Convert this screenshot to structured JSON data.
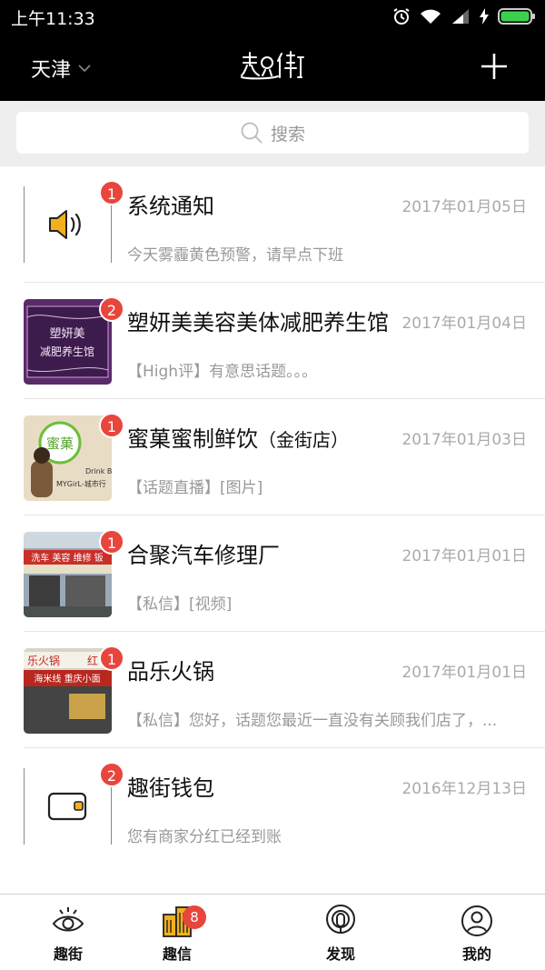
{
  "status_bar": {
    "time": "上午11:33"
  },
  "nav": {
    "city": "天津",
    "logo": "趣街"
  },
  "search": {
    "placeholder": "搜索"
  },
  "messages": [
    {
      "title": "系统通知",
      "subtitle": "",
      "date": "2017年01月05日",
      "preview": "今天雾霾黄色预警，请早点下班",
      "badge": "1",
      "icon": "speaker-icon"
    },
    {
      "title": "塑妍美美容美体减肥养生馆",
      "subtitle": "",
      "date": "2017年01月04日",
      "preview": "【High评】有意思话题。。。",
      "badge": "2",
      "thumb_text": "塑妍美 减肥养生馆"
    },
    {
      "title": "蜜菓蜜制鲜饮",
      "subtitle": "（金街店）",
      "date": "2017年01月03日",
      "preview": "【话题直播】[图片]",
      "badge": "1",
      "thumb_text": "蜜菓 Drink Best MYGirL-城市行"
    },
    {
      "title": "合聚汽车修理厂",
      "subtitle": "",
      "date": "2017年01月01日",
      "preview": "【私信】[视频]",
      "badge": "1",
      "thumb_text": "洗车 美容 维修 钣"
    },
    {
      "title": "品乐火锅",
      "subtitle": "",
      "date": "2017年01月01日",
      "preview": "【私信】您好，话题您最近一直没有关顾我们店了，...",
      "badge": "1",
      "thumb_text": "乐火锅 红 海米线 重庆小面"
    },
    {
      "title": "趣街钱包",
      "subtitle": "",
      "date": "2016年12月13日",
      "preview": "您有商家分红已经到账",
      "badge": "2",
      "icon": "wallet-icon"
    }
  ],
  "tabs": [
    {
      "label": "趣街",
      "icon": "eye-icon"
    },
    {
      "label": "趣信",
      "icon": "buildings-icon",
      "badge": "8"
    },
    {
      "label": "发现",
      "icon": "broadcast-icon"
    },
    {
      "label": "我的",
      "icon": "user-icon"
    }
  ],
  "colors": {
    "accent": "#e8453c",
    "nav_bg": "#000000",
    "tab_icon_active": "#f2b01e"
  }
}
